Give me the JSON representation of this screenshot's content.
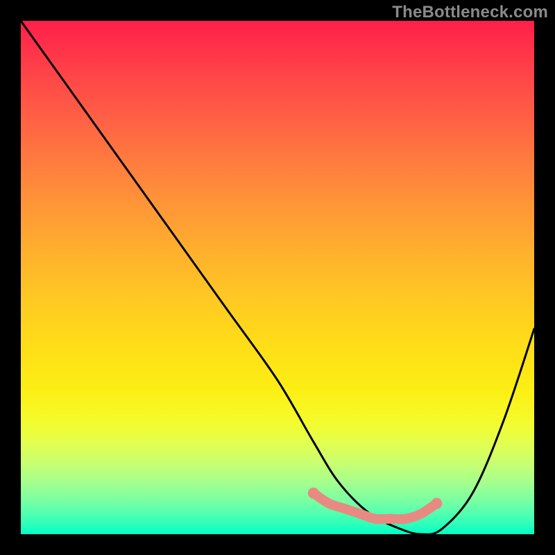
{
  "watermark": "TheBottleneck.com",
  "chart_data": {
    "type": "line",
    "title": "",
    "xlabel": "",
    "ylabel": "",
    "xlim": [
      0,
      100
    ],
    "ylim": [
      0,
      100
    ],
    "series": [
      {
        "name": "bottleneck-curve",
        "x": [
          0,
          10,
          20,
          30,
          40,
          50,
          57,
          62,
          68,
          74,
          78,
          82,
          88,
          94,
          100
        ],
        "values": [
          100,
          86,
          72,
          58,
          44,
          30,
          18,
          10,
          4,
          1,
          0,
          1,
          8,
          22,
          40
        ]
      }
    ],
    "highlight": {
      "name": "optimal-range",
      "x": [
        57,
        60,
        63,
        66,
        69,
        72,
        75,
        78,
        81
      ],
      "values": [
        8,
        6,
        5,
        4,
        3,
        3,
        3,
        4,
        6
      ],
      "color": "#e98a82"
    },
    "gradient_stops": [
      {
        "pos": 0,
        "color": "#ff1f4a"
      },
      {
        "pos": 50,
        "color": "#ffc020"
      },
      {
        "pos": 80,
        "color": "#f4fb2c"
      },
      {
        "pos": 100,
        "color": "#00ffc6"
      }
    ]
  }
}
